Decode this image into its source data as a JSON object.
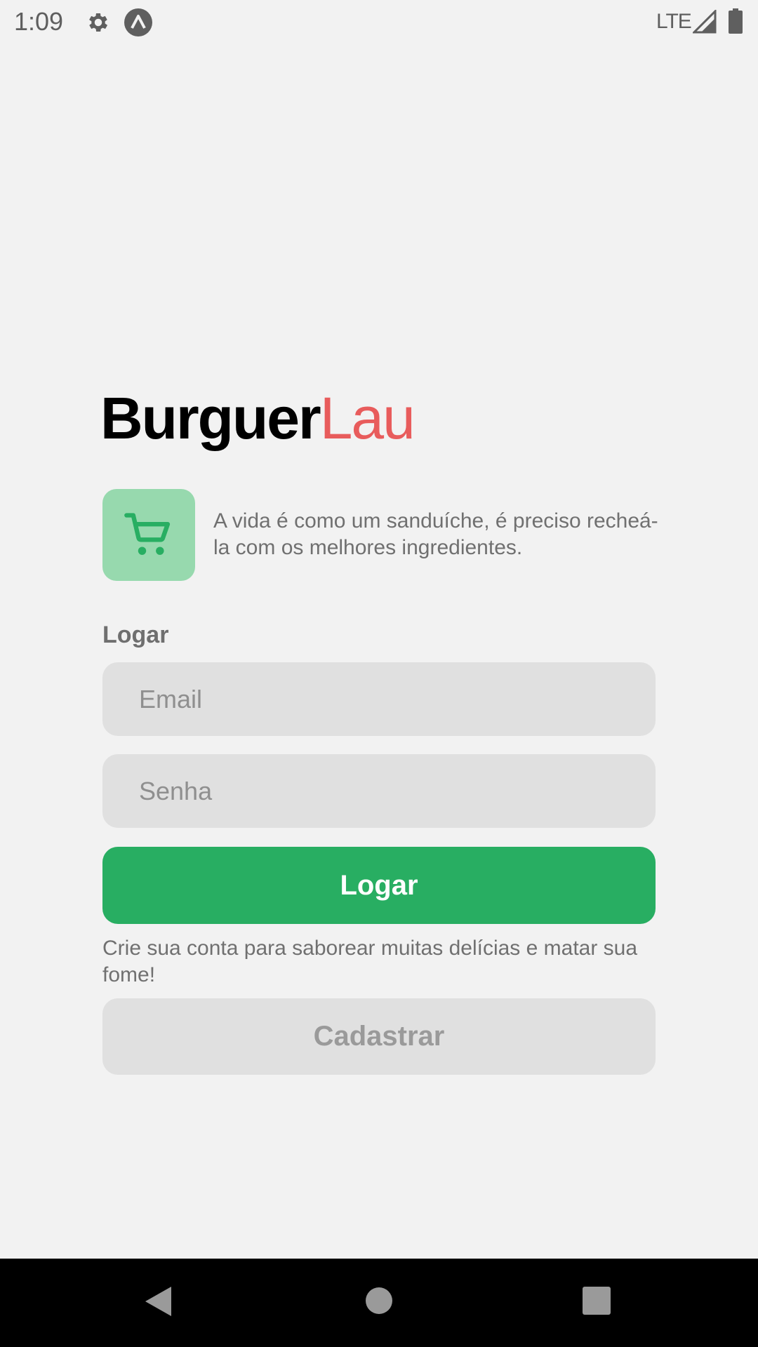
{
  "status_bar": {
    "time": "1:09",
    "network": "LTE",
    "icons": [
      "gear-icon",
      "app-a-icon",
      "signal-icon",
      "battery-icon"
    ]
  },
  "brand": {
    "main": "Burguer",
    "accent": "Lau",
    "accent_color": "#e85c5c"
  },
  "tagline": {
    "icon": "cart-icon",
    "text": "A vida é como um sanduíche, é preciso recheá-la com os melhores ingredientes."
  },
  "login": {
    "section_label": "Logar",
    "email_placeholder": "Email",
    "password_placeholder": "Senha",
    "login_button": "Logar",
    "primary_color": "#28ae62"
  },
  "signup": {
    "text": "Crie sua conta para saborear muitas delícias e matar sua fome!",
    "register_button": "Cadastrar"
  },
  "nav_bar": {
    "icons": [
      "back-icon",
      "home-icon",
      "recents-icon"
    ]
  }
}
